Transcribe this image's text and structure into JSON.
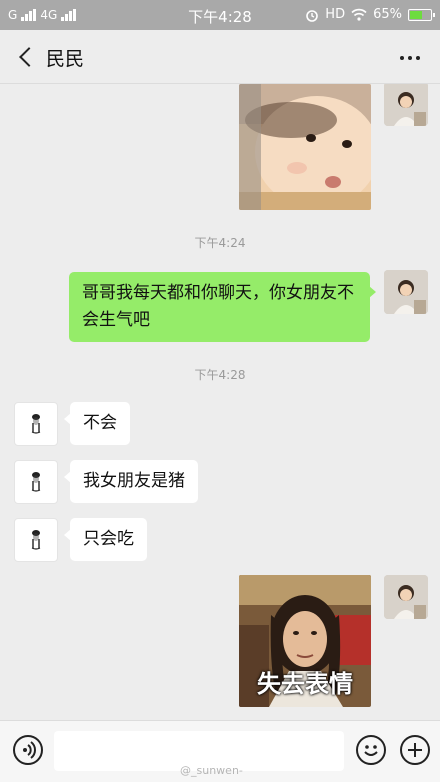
{
  "status_bar": {
    "network": "G",
    "network2": "4G",
    "time": "下午4:28",
    "hd": "HD",
    "battery": "65%",
    "battery_level": 0.65,
    "battery_color": "#6ddc3e"
  },
  "header": {
    "title": "民民"
  },
  "colors": {
    "sent_bubble": "#95ec69",
    "received_bubble": "#ffffff",
    "background": "#ededed"
  },
  "messages": {
    "time_1": "下午4:24",
    "sent_text": "哥哥我每天都和你聊天，你女朋友不会生气吧",
    "time_2": "下午4:28",
    "reply_1": "不会",
    "reply_2": "我女朋友是猪",
    "reply_3": "只会吃",
    "sticker_caption": "失去表情"
  },
  "input": {
    "placeholder": ""
  },
  "watermark": "@_sunwen-"
}
